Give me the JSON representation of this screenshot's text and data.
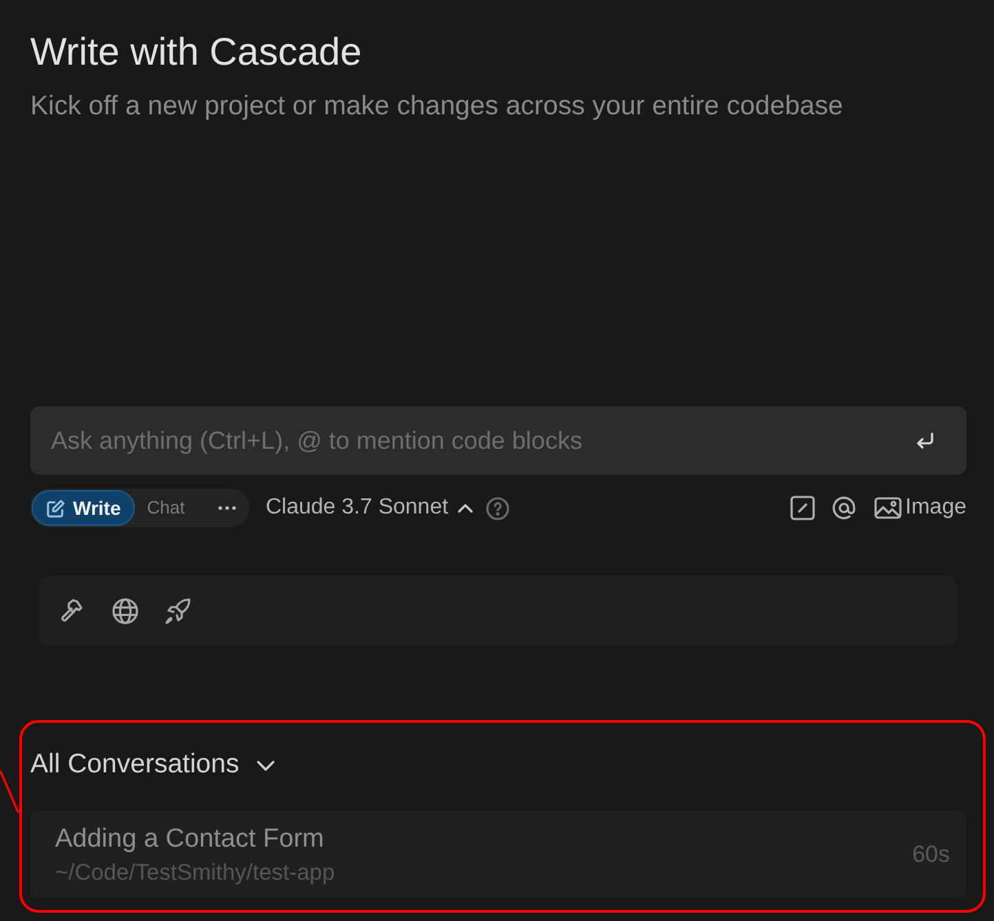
{
  "header": {
    "title": "Write with Cascade",
    "subtitle": "Kick off a new project or make changes across your entire codebase"
  },
  "input": {
    "placeholder": "Ask anything (Ctrl+L), @ to mention code blocks"
  },
  "modes": [
    {
      "label": "Write",
      "selected": true
    },
    {
      "label": "Chat",
      "selected": false
    }
  ],
  "model": {
    "label": "Claude 3.7 Sonnet"
  },
  "attach": {
    "label": "Image"
  },
  "conversations": {
    "title": "All Conversations",
    "highlighted": true,
    "items": [
      {
        "title": "Adding a Contact Form",
        "path": "~/Code/TestSmithy/test-app",
        "time": "60s"
      }
    ]
  }
}
